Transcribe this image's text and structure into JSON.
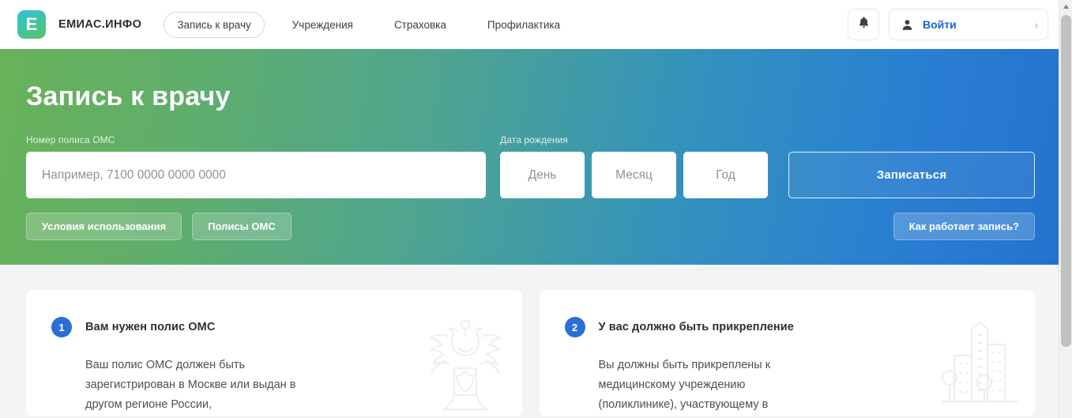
{
  "header": {
    "logo_glyph": "Е",
    "logo_icon": "emias-logo-icon",
    "brand_name": "ЕМИАС.ИНФО",
    "nav": [
      {
        "label": "Запись к врачу",
        "active": true
      },
      {
        "label": "Учреждения",
        "active": false
      },
      {
        "label": "Страховка",
        "active": false
      },
      {
        "label": "Профилактика",
        "active": false
      }
    ],
    "bell_icon": "bell-icon",
    "login": {
      "icon": "person-icon",
      "label": "Войти",
      "chevron": "›"
    }
  },
  "hero": {
    "title": "Запись к врачу",
    "policy": {
      "label": "Номер полиса ОМС",
      "placeholder": "Например, 7100 0000 0000 0000",
      "value": ""
    },
    "dob": {
      "label": "Дата рождения",
      "fields": [
        {
          "placeholder": "День",
          "value": ""
        },
        {
          "placeholder": "Месяц",
          "value": ""
        },
        {
          "placeholder": "Год",
          "value": ""
        }
      ]
    },
    "submit_label": "Записаться",
    "pills": [
      {
        "label": "Условия использования"
      },
      {
        "label": "Полисы ОМС"
      }
    ],
    "help_pill": {
      "label": "Как работает запись?"
    },
    "gradient_from": "#68b259",
    "gradient_to": "#2472ce"
  },
  "cards": [
    {
      "step": "1",
      "title": "Вам нужен полис ОМС",
      "body": "Ваш полис ОМС должен быть зарегистрирован в Москве или выдан в другом регионе России,",
      "watermark_icon": "coat-of-arms-eagle-icon"
    },
    {
      "step": "2",
      "title": "У вас должно быть прикрепление",
      "body": "Вы должны быть прикреплены к медицинскому учреждению (поликлинике), участвующему в",
      "watermark_icon": "city-buildings-icon"
    }
  ],
  "colors": {
    "accent_blue": "#2a6fd6",
    "link_blue": "#1a63d8",
    "text_dark": "#2b2f33",
    "text_body": "#4a5056",
    "page_bg": "#f2f4f5"
  },
  "scrollbar": {
    "up_arrow_icon": "scroll-up-arrow-icon"
  }
}
